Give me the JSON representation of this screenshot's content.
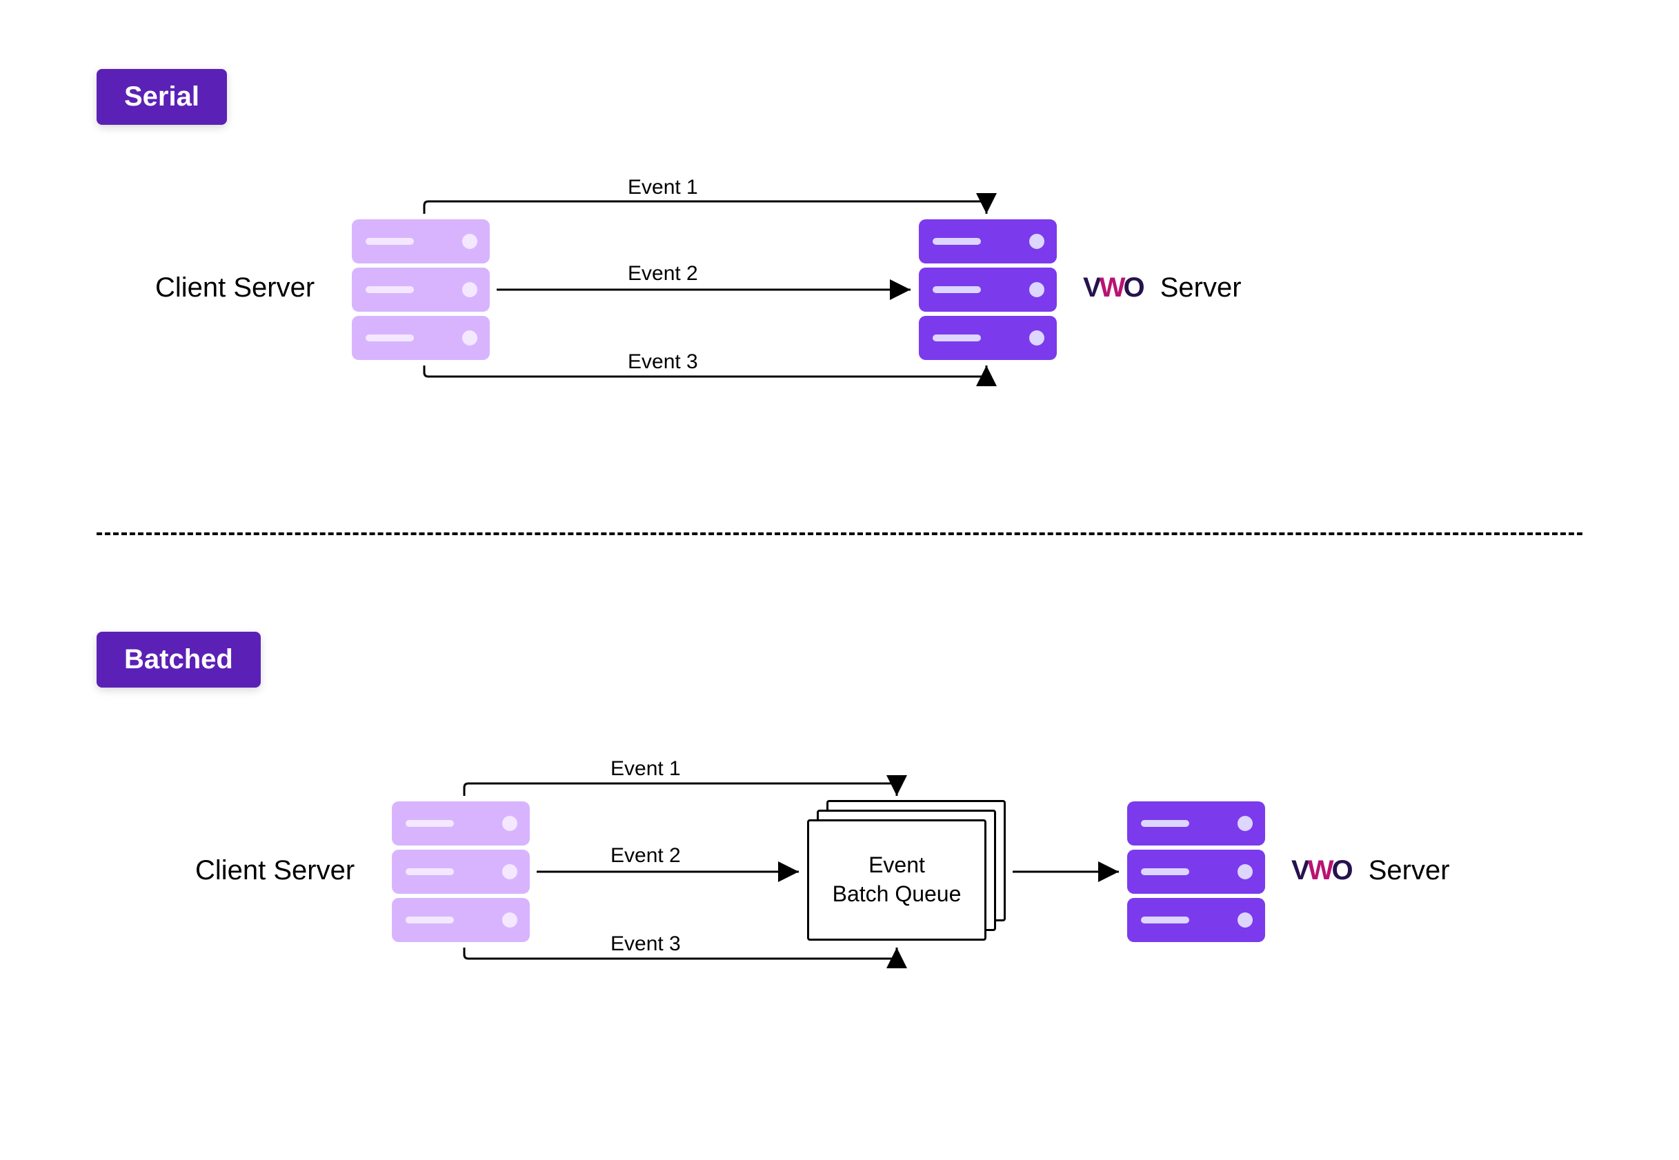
{
  "badges": {
    "serial": "Serial",
    "batched": "Batched"
  },
  "labels": {
    "client_server": "Client Server",
    "vwo_server": "Server",
    "vwo_brand_v": "V",
    "vwo_brand_w": "W",
    "vwo_brand_o": "O"
  },
  "events": {
    "e1": "Event 1",
    "e2": "Event 2",
    "e3": "Event 3"
  },
  "queue": {
    "line1": "Event",
    "line2": "Batch Queue"
  },
  "colors": {
    "badge_bg": "#5b21b6",
    "server_light": "#d8b4fe",
    "server_dark": "#7c3aed",
    "brand_dark": "#26134d",
    "brand_pink": "#b91372"
  }
}
